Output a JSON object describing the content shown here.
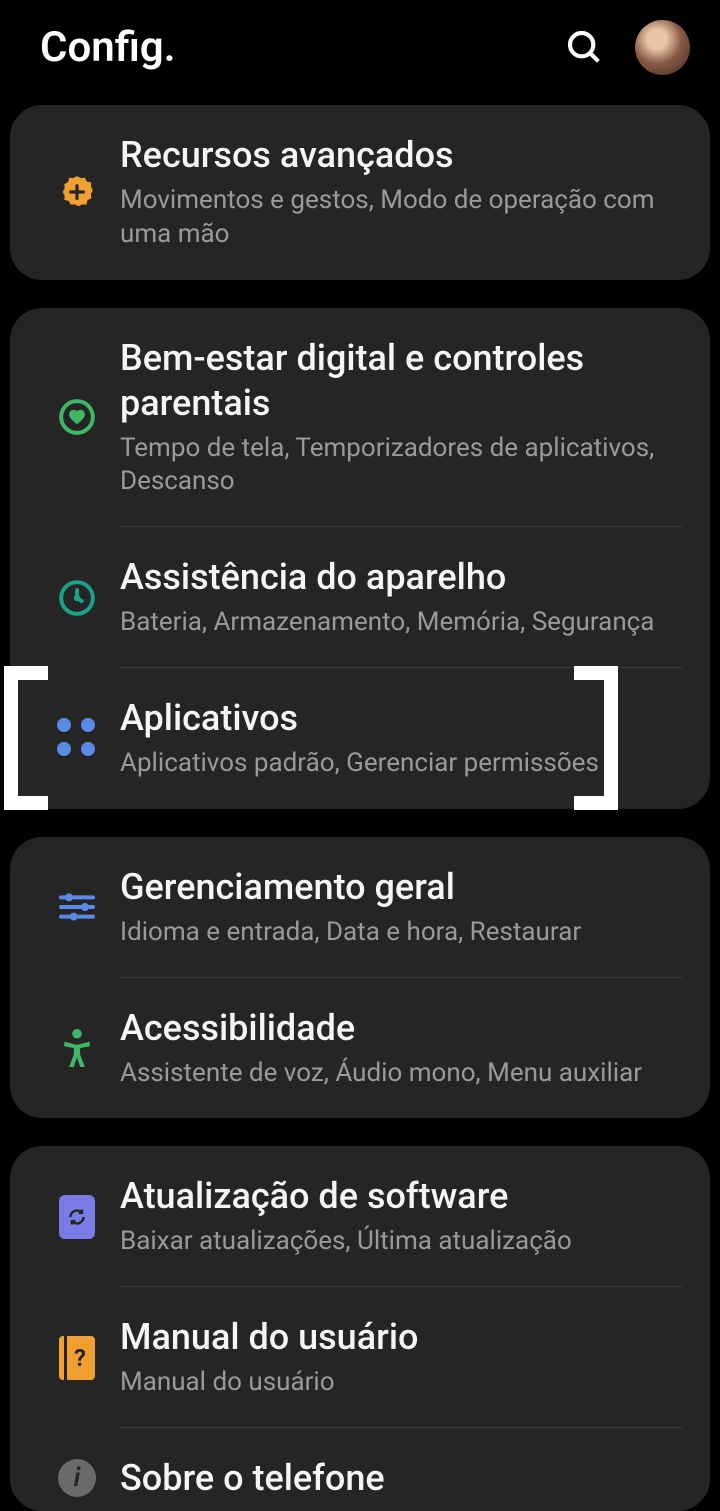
{
  "header": {
    "title": "Config."
  },
  "groups": [
    {
      "items": [
        {
          "icon": "advanced-icon",
          "title": "Recursos avançados",
          "subtitle": "Movimentos e gestos, Modo de operação com uma mão"
        }
      ]
    },
    {
      "items": [
        {
          "icon": "wellbeing-icon",
          "title": "Bem-estar digital e controles parentais",
          "subtitle": "Tempo de tela, Temporizadores de aplicativos, Descanso"
        },
        {
          "icon": "device-care-icon",
          "title": "Assistência do aparelho",
          "subtitle": "Bateria, Armazenamento, Memória, Segurança"
        },
        {
          "icon": "apps-icon",
          "title": "Aplicativos",
          "subtitle": "Aplicativos padrão, Gerenciar permissões",
          "highlighted": true
        }
      ]
    },
    {
      "items": [
        {
          "icon": "general-icon",
          "title": "Gerenciamento geral",
          "subtitle": "Idioma e entrada, Data e hora, Restaurar"
        },
        {
          "icon": "accessibility-icon",
          "title": "Acessibilidade",
          "subtitle": "Assistente de voz, Áudio mono, Menu auxiliar"
        }
      ]
    },
    {
      "items": [
        {
          "icon": "update-icon",
          "title": "Atualização de software",
          "subtitle": "Baixar atualizações, Última atualização"
        },
        {
          "icon": "manual-icon",
          "title": "Manual do usuário",
          "subtitle": "Manual do usuário"
        },
        {
          "icon": "about-icon",
          "title": "Sobre o telefone",
          "subtitle": ""
        }
      ]
    }
  ]
}
